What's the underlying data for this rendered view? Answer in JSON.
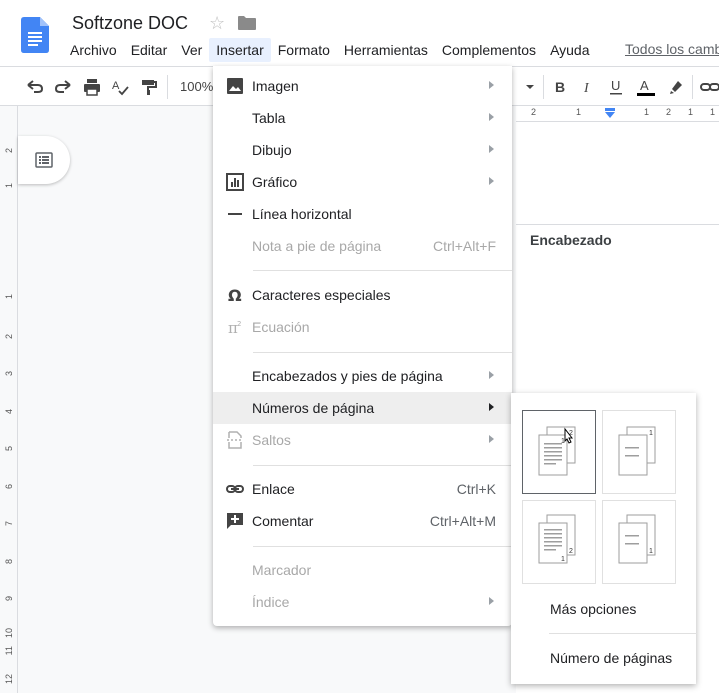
{
  "document": {
    "title": "Softzone DOC"
  },
  "menubar": {
    "items": [
      "Archivo",
      "Editar",
      "Ver",
      "Insertar",
      "Formato",
      "Herramientas",
      "Complementos",
      "Ayuda"
    ],
    "all_changes": "Todos los camb"
  },
  "toolbar": {
    "zoom": "100%"
  },
  "ruler": {
    "horizontal": [
      "2",
      "1",
      "1",
      "2",
      "1",
      "1"
    ],
    "vertical": [
      "2",
      "1",
      "1",
      "2",
      "3",
      "4",
      "5",
      "6",
      "7",
      "8",
      "9",
      "10",
      "11",
      "12"
    ]
  },
  "page": {
    "header_label": "Encabezado"
  },
  "insert_menu": {
    "items": [
      {
        "label": "Imagen",
        "icon": "image-icon"
      },
      {
        "label": "Tabla"
      },
      {
        "label": "Dibujo"
      },
      {
        "label": "Gráfico",
        "icon": "chart-icon"
      },
      {
        "label": "Línea horizontal",
        "icon": "horizontal-line-icon"
      },
      {
        "label": "Nota a pie de página",
        "shortcut": "Ctrl+Alt+F"
      },
      {
        "label": "Caracteres especiales",
        "icon": "omega-icon"
      },
      {
        "label": "Ecuación",
        "icon": "pi-icon"
      },
      {
        "label": "Encabezados y pies de página"
      },
      {
        "label": "Números de página"
      },
      {
        "label": "Saltos",
        "icon": "page-break-icon"
      },
      {
        "label": "Enlace",
        "icon": "link-icon",
        "shortcut": "Ctrl+K"
      },
      {
        "label": "Comentar",
        "icon": "add-comment-icon",
        "shortcut": "Ctrl+Alt+M"
      },
      {
        "label": "Marcador"
      },
      {
        "label": "Índice"
      }
    ]
  },
  "page_numbers_submenu": {
    "tile_numbers": [
      "2",
      "1",
      "2",
      "1",
      "1",
      "1"
    ],
    "more_options": "Más opciones",
    "page_count": "Número de páginas"
  },
  "colors": {
    "accent_blue": "#4285f4",
    "menu_hover": "#eeeeee",
    "active_menu": "#e8f0fe"
  }
}
